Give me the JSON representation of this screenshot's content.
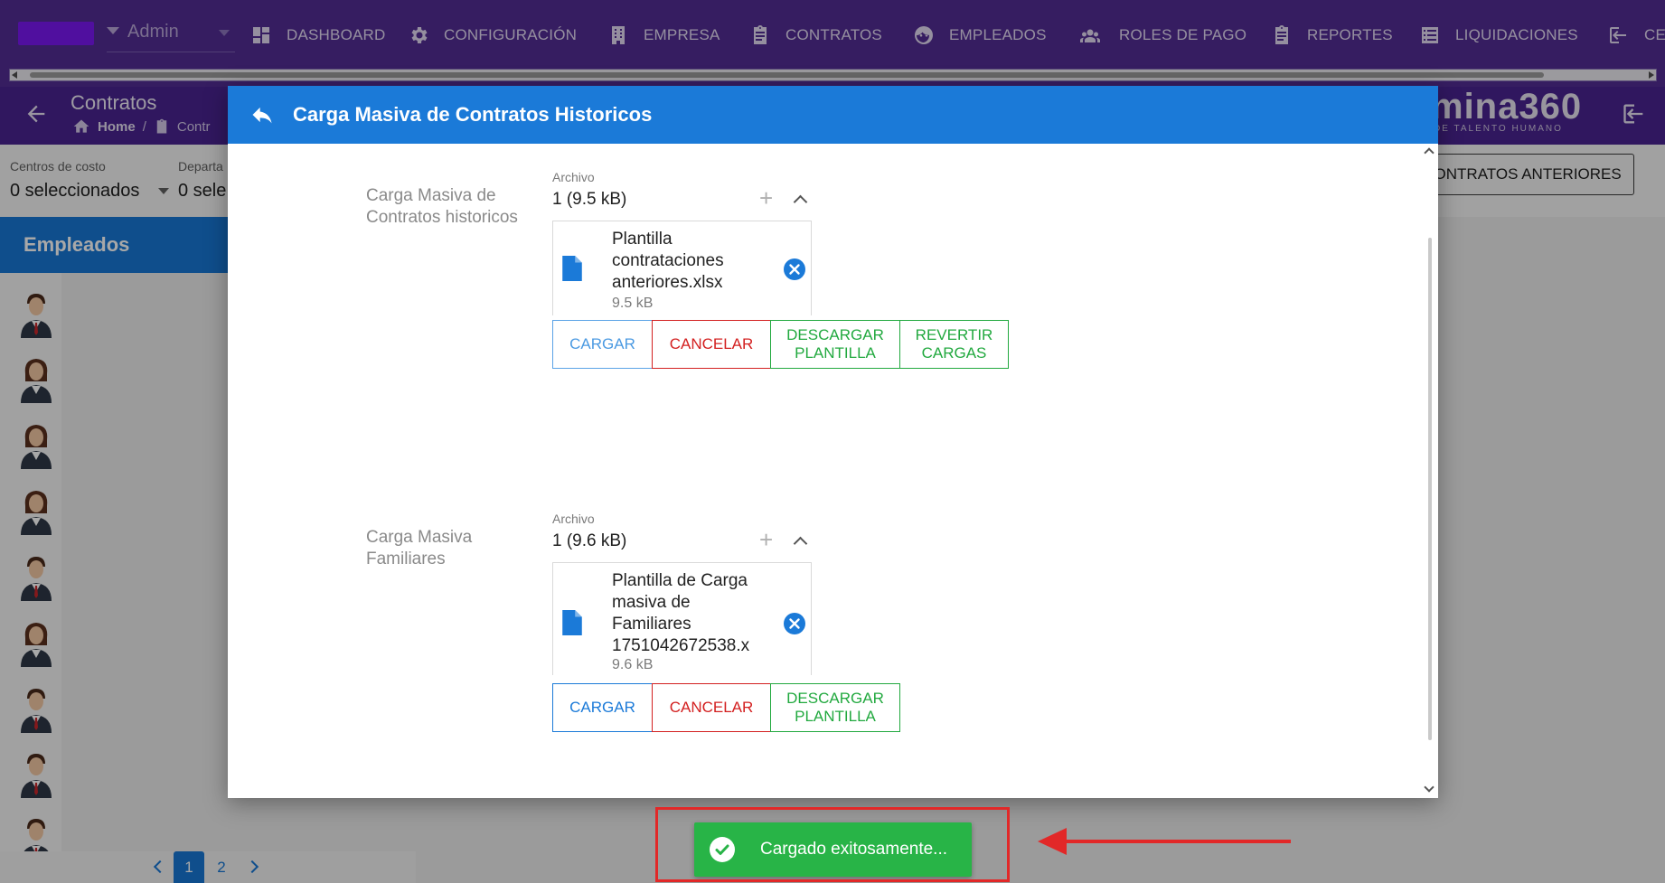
{
  "topnav": {
    "role_label": "Admin",
    "items": [
      {
        "label": "DASHBOARD",
        "icon": "dashboard-icon"
      },
      {
        "label": "CONFIGURACIÓN",
        "icon": "gear-icon"
      },
      {
        "label": "EMPRESA",
        "icon": "building-icon"
      },
      {
        "label": "CONTRATOS",
        "icon": "clipboard-icon"
      },
      {
        "label": "EMPLEADOS",
        "icon": "face-icon"
      },
      {
        "label": "ROLES DE PAGO",
        "icon": "people-icon"
      },
      {
        "label": "REPORTES",
        "icon": "clipboard-icon"
      },
      {
        "label": "LIQUIDACIONES",
        "icon": "list-icon"
      },
      {
        "label": "CE",
        "icon": "logout-icon"
      }
    ]
  },
  "subheader": {
    "title": "Contratos",
    "breadcrumb": [
      "Home",
      "Contr"
    ],
    "brand": "mina360",
    "brand_sub": "DE TALENTO HUMANO"
  },
  "filters": {
    "cost_center_label": "Centros de costo",
    "cost_center_value": "0 seleccionados",
    "department_label": "Departa",
    "department_value": "0 sele",
    "prev_contracts_button": "CONTRATOS ANTERIORES"
  },
  "employees": {
    "title": "Empleados",
    "pages": [
      "1",
      "2"
    ],
    "active_page": "1"
  },
  "modal": {
    "title": "Carga Masiva de Contratos Historicos",
    "sections": [
      {
        "label": "Carga Masiva de Contratos historicos",
        "file_caption": "Archivo",
        "file_count": "1 (9.5 kB)",
        "file_name": "Plantilla contrataciones anteriores.xlsx",
        "file_size": "9.5 kB",
        "buttons": [
          "CARGAR",
          "CANCELAR",
          "DESCARGAR PLANTILLA",
          "REVERTIR CARGAS"
        ]
      },
      {
        "label": "Carga Masiva Familiares",
        "file_caption": "Archivo",
        "file_count": "1 (9.6 kB)",
        "file_name": "Plantilla de Carga masiva de Familiares 1751042672538.x",
        "file_size": "9.6 kB",
        "buttons": [
          "CARGAR",
          "CANCELAR",
          "DESCARGAR PLANTILLA"
        ]
      }
    ]
  },
  "toast": {
    "message": "Cargado exitosamente...",
    "color": "#28b447"
  },
  "colors": {
    "nav": "#532c94",
    "primary": "#1b7ad8",
    "danger": "#d32020",
    "success": "#22a93f",
    "annotation": "#e22828"
  }
}
